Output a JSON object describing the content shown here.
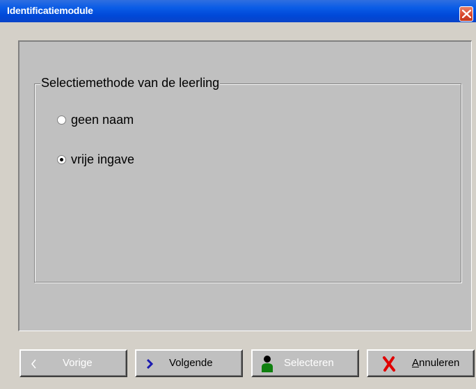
{
  "window": {
    "title": "Identificatiemodule"
  },
  "group": {
    "legend": "Selectiemethode van de  leerling",
    "options": [
      {
        "label": "geen naam",
        "checked": false
      },
      {
        "label": "vrije ingave",
        "checked": true
      }
    ]
  },
  "buttons": {
    "previous": {
      "label": "Vorige",
      "enabled": false
    },
    "next": {
      "label": "Volgende",
      "enabled": true
    },
    "select": {
      "label": "Selecteren",
      "enabled": false
    },
    "cancel": {
      "label": "Annuleren",
      "accelerator": "A",
      "enabled": true
    }
  },
  "colors": {
    "titlebar": "#0a5ce6",
    "close_button": "#d8442a",
    "dialog_face": "#d4d0c8",
    "panel_face": "#c0c0c0",
    "next_icon": "#1a1ab0",
    "cancel_icon": "#e00000",
    "person_body": "#108010"
  }
}
